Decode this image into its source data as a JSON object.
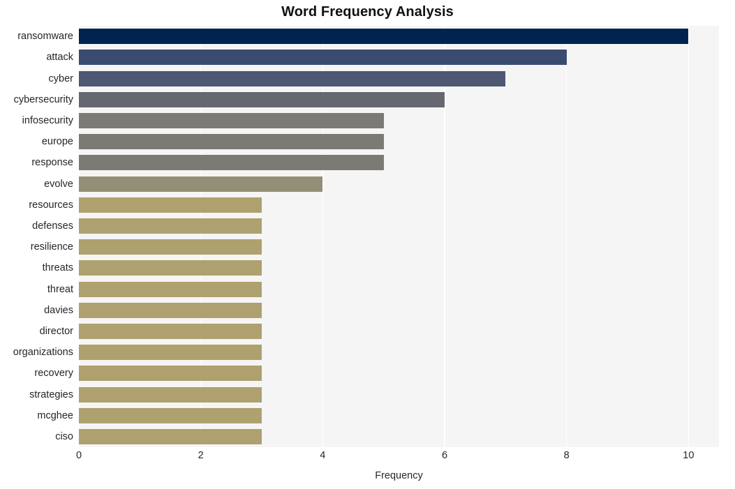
{
  "chart_data": {
    "type": "bar",
    "orientation": "horizontal",
    "title": "Word Frequency Analysis",
    "xlabel": "Frequency",
    "ylabel": "",
    "xlim": [
      0,
      10.5
    ],
    "xticks": [
      0,
      2,
      4,
      6,
      8,
      10
    ],
    "xtick_labels": [
      "0",
      "2",
      "4",
      "6",
      "8",
      "10"
    ],
    "grid": true,
    "grid_axis": "x",
    "legend": "none",
    "categories": [
      "ransomware",
      "attack",
      "cyber",
      "cybersecurity",
      "infosecurity",
      "europe",
      "response",
      "evolve",
      "resources",
      "defenses",
      "resilience",
      "threats",
      "threat",
      "davies",
      "director",
      "organizations",
      "recovery",
      "strategies",
      "mcghee",
      "ciso"
    ],
    "values": [
      10,
      8,
      7,
      6,
      5,
      5,
      5,
      4,
      3,
      3,
      3,
      3,
      3,
      3,
      3,
      3,
      3,
      3,
      3,
      3
    ],
    "bar_colors": [
      "#00234f",
      "#394b70",
      "#4e5872",
      "#656871",
      "#7b7a75",
      "#7b7a75",
      "#7b7a75",
      "#938f76",
      "#aea16f",
      "#aea16f",
      "#aea16f",
      "#aea16f",
      "#aea16f",
      "#aea16f",
      "#aea16f",
      "#aea16f",
      "#aea16f",
      "#aea16f",
      "#aea16f",
      "#aea16f"
    ],
    "colors": {
      "plot_background": "#f5f5f5",
      "figure_background": "#ffffff",
      "gridline": "#ffffff",
      "tick_label": "#262626",
      "title": "#111111"
    }
  }
}
